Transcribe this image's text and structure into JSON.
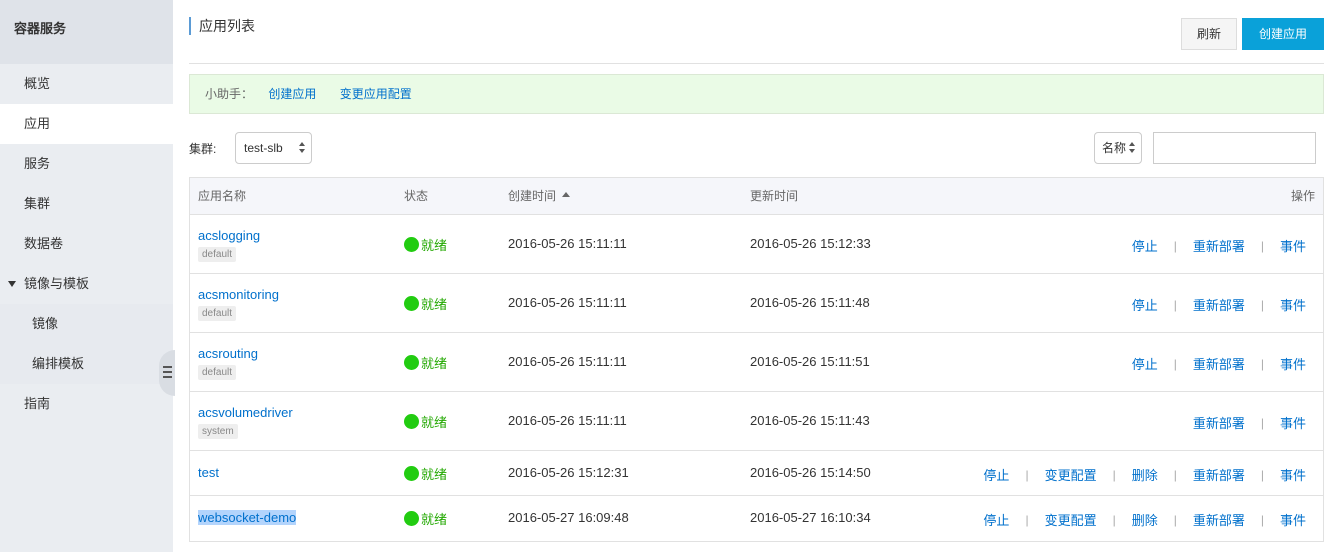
{
  "sidebar": {
    "title": "容器服务",
    "items": [
      {
        "label": "概览"
      },
      {
        "label": "应用"
      },
      {
        "label": "服务"
      },
      {
        "label": "集群"
      },
      {
        "label": "数据卷"
      },
      {
        "label": "镜像与模板"
      },
      {
        "label": "镜像"
      },
      {
        "label": "编排模板"
      },
      {
        "label": "指南"
      }
    ],
    "active": "应用"
  },
  "header": {
    "title": "应用列表",
    "refresh_label": "刷新",
    "create_label": "创建应用"
  },
  "helper": {
    "label": "小助手：",
    "links": [
      "创建应用",
      "变更应用配置"
    ]
  },
  "filters": {
    "cluster_label": "集群:",
    "cluster_value": "test-slb",
    "search_field": "名称",
    "search_value": ""
  },
  "table": {
    "columns": [
      "应用名称",
      "状态",
      "创建时间",
      "更新时间",
      "操作"
    ],
    "sort_column": "创建时间",
    "sort_direction": "ascending",
    "rows": [
      {
        "name": "acslogging",
        "tag": "default",
        "status": "就绪",
        "created": "2016-05-26 15:11:11",
        "updated": "2016-05-26 15:12:33",
        "actions": [
          "停止",
          "重新部署",
          "事件"
        ]
      },
      {
        "name": "acsmonitoring",
        "tag": "default",
        "status": "就绪",
        "created": "2016-05-26 15:11:11",
        "updated": "2016-05-26 15:11:48",
        "actions": [
          "停止",
          "重新部署",
          "事件"
        ]
      },
      {
        "name": "acsrouting",
        "tag": "default",
        "status": "就绪",
        "created": "2016-05-26 15:11:11",
        "updated": "2016-05-26 15:11:51",
        "actions": [
          "停止",
          "重新部署",
          "事件"
        ]
      },
      {
        "name": "acsvolumedriver",
        "tag": "system",
        "status": "就绪",
        "created": "2016-05-26 15:11:11",
        "updated": "2016-05-26 15:11:43",
        "actions": [
          "重新部署",
          "事件"
        ]
      },
      {
        "name": "test",
        "tag": "",
        "status": "就绪",
        "created": "2016-05-26 15:12:31",
        "updated": "2016-05-26 15:14:50",
        "actions": [
          "停止",
          "变更配置",
          "删除",
          "重新部署",
          "事件"
        ]
      },
      {
        "name": "websocket-demo",
        "tag": "",
        "status": "就绪",
        "created": "2016-05-27 16:09:48",
        "updated": "2016-05-27 16:10:34",
        "actions": [
          "停止",
          "变更配置",
          "删除",
          "重新部署",
          "事件"
        ],
        "selected": true
      }
    ]
  },
  "colors": {
    "accent": "#0aa1d9",
    "link": "#0070cc",
    "status_ok": "#22cc11",
    "helper_bg": "#eafbe6",
    "sidebar_bg": "#eaedf1"
  }
}
